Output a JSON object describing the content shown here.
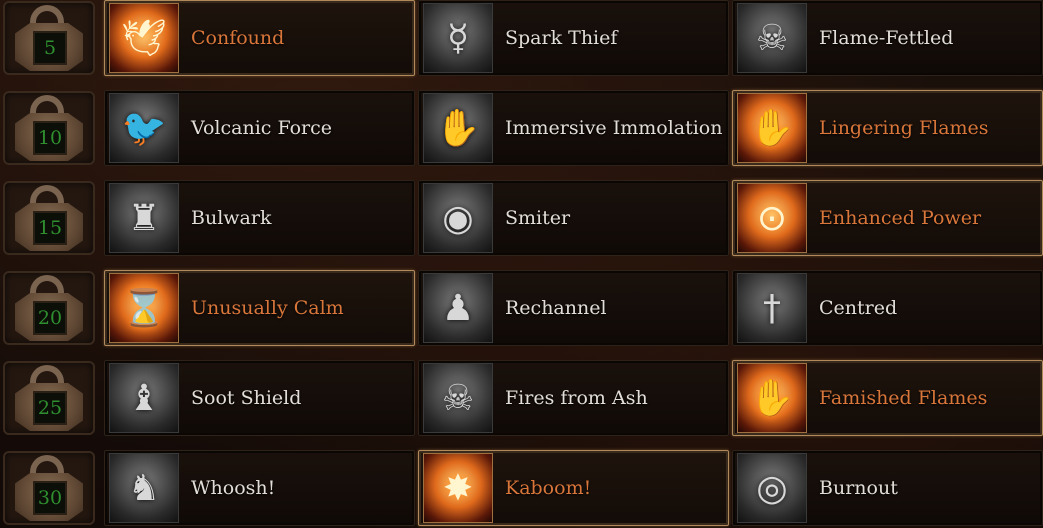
{
  "colors": {
    "selected_text": "#d9763a",
    "normal_text": "#e2ddd6",
    "level_text": "#2f8f2f",
    "selected_frame": "#b08a5a"
  },
  "rows": [
    {
      "level": "5",
      "skills": [
        {
          "name": "Confound",
          "icon": "dove-icon",
          "selected": true
        },
        {
          "name": "Spark Thief",
          "icon": "winged-sigil-icon",
          "selected": false
        },
        {
          "name": "Flame-Fettled",
          "icon": "horned-skull-icon",
          "selected": false
        }
      ]
    },
    {
      "level": "10",
      "skills": [
        {
          "name": "Volcanic Force",
          "icon": "raven-icon",
          "selected": false
        },
        {
          "name": "Immersive Immolation",
          "icon": "grasping-hand-icon",
          "selected": false
        },
        {
          "name": "Lingering Flames",
          "icon": "glowing-hand-icon",
          "selected": true
        }
      ]
    },
    {
      "level": "15",
      "skills": [
        {
          "name": "Bulwark",
          "icon": "cloaked-figure-icon",
          "selected": false
        },
        {
          "name": "Smiter",
          "icon": "dark-sphere-icon",
          "selected": false
        },
        {
          "name": "Enhanced Power",
          "icon": "fire-ring-icon",
          "selected": true
        }
      ]
    },
    {
      "level": "20",
      "skills": [
        {
          "name": "Unusually Calm",
          "icon": "hourglass-icon",
          "selected": true
        },
        {
          "name": "Rechannel",
          "icon": "shadow-figure-icon",
          "selected": false
        },
        {
          "name": "Centred",
          "icon": "sword-icon",
          "selected": false
        }
      ]
    },
    {
      "level": "25",
      "skills": [
        {
          "name": "Soot Shield",
          "icon": "shielded-figure-icon",
          "selected": false
        },
        {
          "name": "Fires from Ash",
          "icon": "skull-icon",
          "selected": false
        },
        {
          "name": "Famished Flames",
          "icon": "burning-hand-icon",
          "selected": true
        }
      ]
    },
    {
      "level": "30",
      "skills": [
        {
          "name": "Whoosh!",
          "icon": "rising-figure-icon",
          "selected": false
        },
        {
          "name": "Kaboom!",
          "icon": "exploding-figure-icon",
          "selected": true
        },
        {
          "name": "Burnout",
          "icon": "figure-in-rings-icon",
          "selected": false
        }
      ]
    }
  ]
}
